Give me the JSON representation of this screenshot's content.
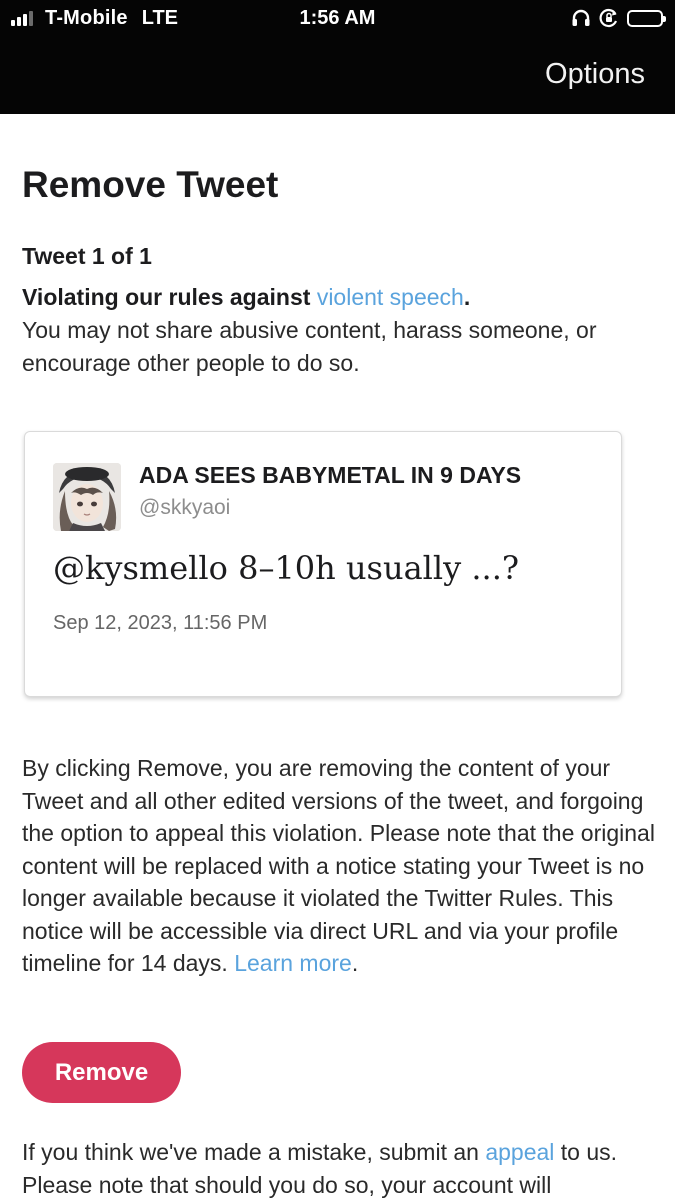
{
  "status_bar": {
    "carrier": "T-Mobile",
    "network": "LTE",
    "time": "1:56 AM",
    "signal_bars": 4,
    "signal_bars_active": 3,
    "battery_level": 0.95,
    "icons": [
      "headphones-icon",
      "orientation-lock-icon",
      "battery-icon"
    ]
  },
  "nav": {
    "options_label": "Options"
  },
  "page": {
    "title": "Remove Tweet",
    "tweet_count": "Tweet 1 of 1",
    "rule_prefix": "Violating our rules against ",
    "rule_link": "violent speech",
    "rule_suffix": ".",
    "rule_description": "You may not share abusive content, harass someone, or encourage other people to do so."
  },
  "tweet": {
    "display_name": "ADA SEES BABYMETAL IN 9 DAYS",
    "handle": "@skkyaoi",
    "text": "@kysmello 8–10h usually ...?",
    "date": "Sep 12, 2023, 11:56 PM"
  },
  "notice": {
    "body": "By clicking Remove, you are removing the content of your Tweet and all other edited versions of the tweet, and forgoing the option to appeal this violation. Please note that the original content will be replaced with a notice stating your Tweet is no longer available because it violated the Twitter Rules. This notice will be accessible via direct URL and via your profile timeline for 14 days. ",
    "learn_more": "Learn more",
    "end": "."
  },
  "actions": {
    "remove_label": "Remove"
  },
  "footer": {
    "prefix": "If you think we've made a mistake, submit an ",
    "appeal_link": "appeal",
    "suffix": " to us. Please note that should you do so, your account will"
  },
  "colors": {
    "link": "#5aa3dd",
    "remove_button": "#d6375b",
    "top_bar": "#050505"
  }
}
